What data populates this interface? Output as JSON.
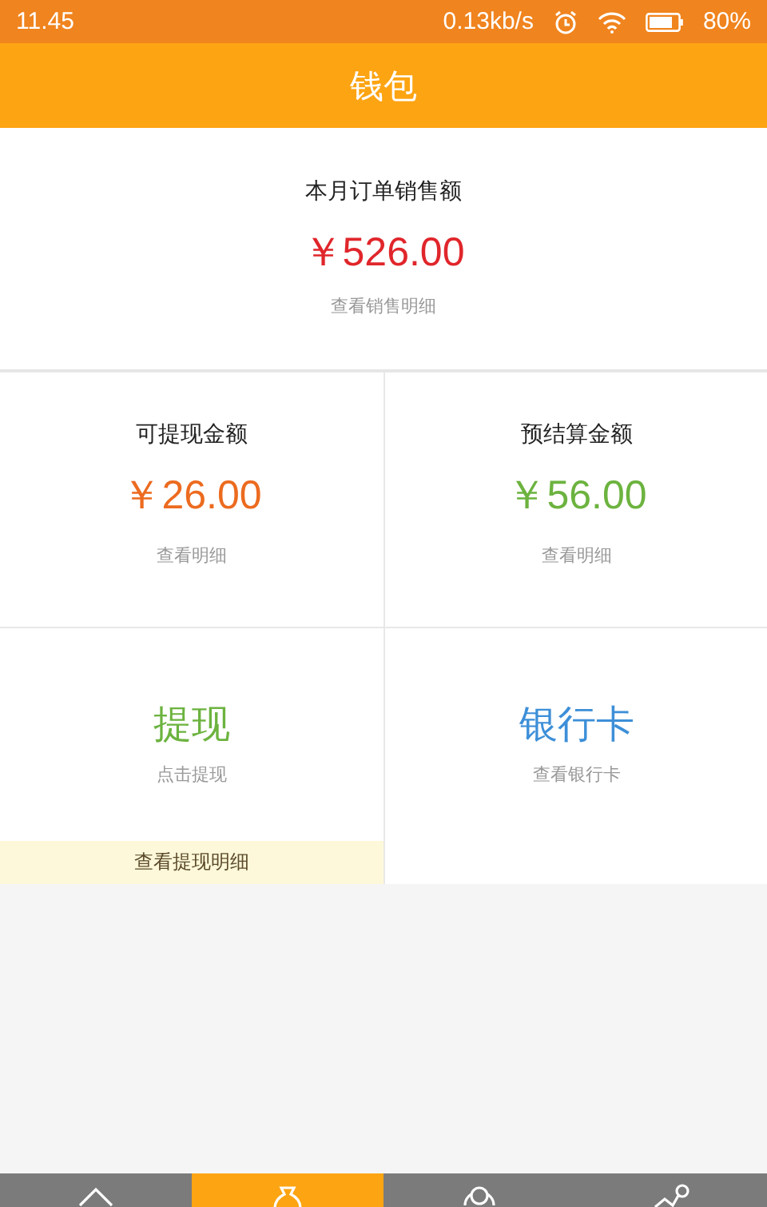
{
  "status_bar": {
    "time": "11.45",
    "net_speed": "0.13kb/s",
    "battery": "80%"
  },
  "header": {
    "title": "钱包"
  },
  "sales": {
    "label": "本月订单销售额",
    "amount": "￥526.00",
    "link": "查看销售明细"
  },
  "balances": [
    {
      "label": "可提现金额",
      "amount": "￥26.00",
      "link": "查看明细",
      "color": "#ec6b1f"
    },
    {
      "label": "预结算金额",
      "amount": "￥56.00",
      "link": "查看明细",
      "color": "#6cb33f"
    }
  ],
  "actions": [
    {
      "title": "提现",
      "subtitle": "点击提现",
      "footer": "查看提现明细",
      "color": "#6cb33f"
    },
    {
      "title": "银行卡",
      "subtitle": "查看银行卡",
      "color": "#3d8fd8"
    }
  ],
  "tabs": [
    {
      "kind": "home",
      "selected": false
    },
    {
      "kind": "bag",
      "selected": true
    },
    {
      "kind": "people",
      "selected": false
    },
    {
      "kind": "share",
      "selected": false
    }
  ]
}
